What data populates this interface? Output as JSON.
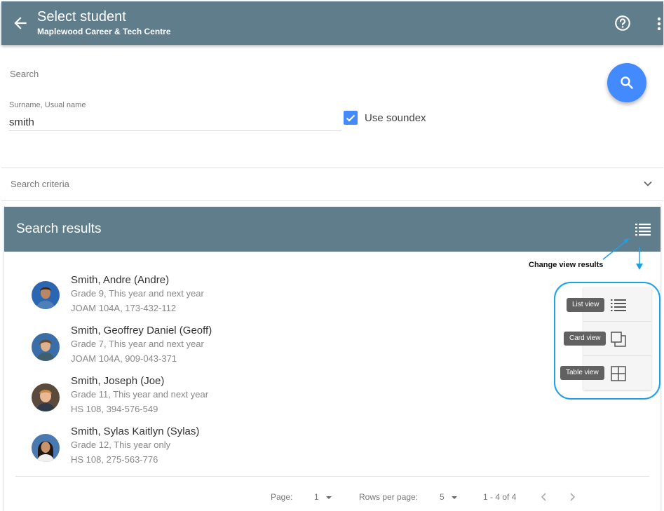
{
  "appbar": {
    "title": "Select student",
    "subtitle": "Maplewood Career & Tech Centre",
    "back_icon": "arrow-back-icon",
    "help_icon": "help-circle-icon",
    "more_icon": "more-vertical-icon",
    "color": "#607d8b"
  },
  "search": {
    "label": "Search",
    "field_label": "Surname, Usual name",
    "field_value": "smith",
    "soundex_label": "Use soundex",
    "soundex_checked": true,
    "button_icon": "search-icon",
    "button_color": "#448aff"
  },
  "criteria": {
    "label": "Search criteria",
    "icon": "chevron-down-icon"
  },
  "results": {
    "title": "Search results",
    "view_icon": "list-view-icon",
    "students": [
      {
        "name": "Smith, Andre (Andre)",
        "grade": "Grade 9, This year and next year",
        "info": "JOAM 104A, 173-432-112"
      },
      {
        "name": "Smith, Geoffrey Daniel (Geoff)",
        "grade": "Grade 7, This year and next year",
        "info": "JOAM 104A, 909-043-371"
      },
      {
        "name": "Smith, Joseph (Joe)",
        "grade": "Grade 11, This year and next year",
        "info": "HS 108, 394-576-549"
      },
      {
        "name": "Smith, Sylas Kaitlyn (Sylas)",
        "grade": "Grade 12, This year only",
        "info": "HS 108, 275-563-776"
      }
    ]
  },
  "pagination": {
    "page_label": "Page:",
    "page_value": "1",
    "rows_label": "Rows per page:",
    "rows_value": "5",
    "range": "1 - 4 of 4"
  },
  "annotation": {
    "text": "Change view results",
    "color": "#1da1e6",
    "options": [
      {
        "label": "List view",
        "icon": "list-view-icon"
      },
      {
        "label": "Card view",
        "icon": "card-view-icon"
      },
      {
        "label": "Table view",
        "icon": "table-view-icon"
      }
    ]
  }
}
